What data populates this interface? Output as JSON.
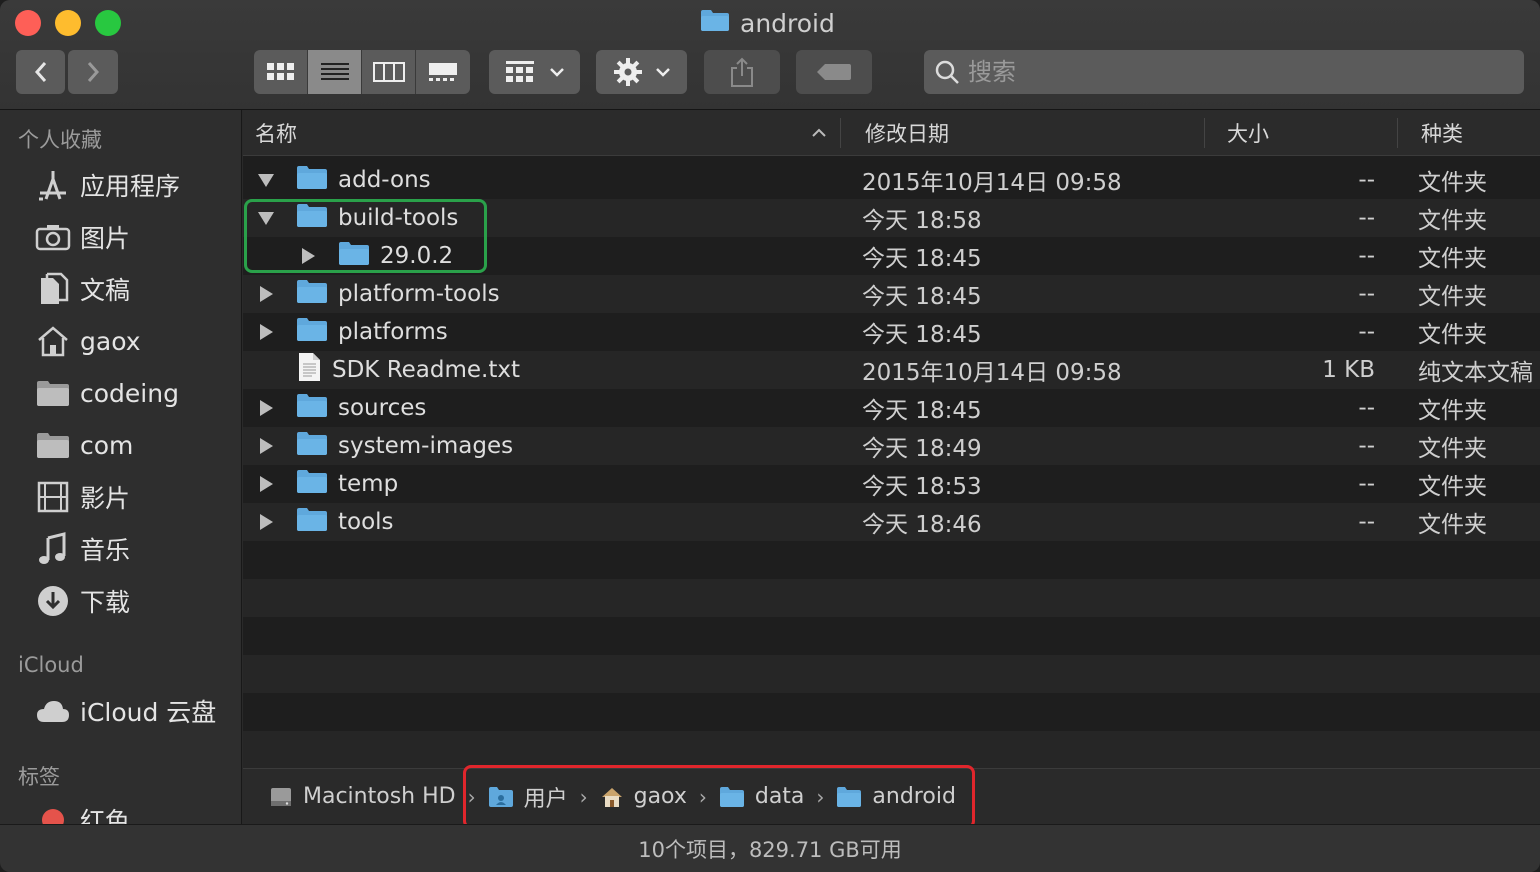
{
  "window": {
    "title": "android"
  },
  "search": {
    "placeholder": "搜索"
  },
  "sidebar": {
    "favorites_title": "个人收藏",
    "favorites": [
      {
        "label": "应用程序",
        "icon": "applications-icon"
      },
      {
        "label": "图片",
        "icon": "camera-icon"
      },
      {
        "label": "文稿",
        "icon": "documents-icon"
      },
      {
        "label": "gaox",
        "icon": "home-icon"
      },
      {
        "label": "codeing",
        "icon": "folder-icon"
      },
      {
        "label": "com",
        "icon": "folder-icon"
      },
      {
        "label": "影片",
        "icon": "film-icon"
      },
      {
        "label": "音乐",
        "icon": "music-icon"
      },
      {
        "label": "下载",
        "icon": "download-icon"
      }
    ],
    "icloud_title": "iCloud",
    "icloud": [
      {
        "label": "iCloud 云盘",
        "icon": "cloud-icon"
      }
    ],
    "tags_title": "标签",
    "tags": [
      {
        "label": "红色",
        "color": "#e5534b"
      }
    ]
  },
  "columns": {
    "name": "名称",
    "date": "修改日期",
    "size": "大小",
    "kind": "种类"
  },
  "files": [
    {
      "name": "add-ons",
      "date": "2015年10月14日 09:58",
      "size": "--",
      "kind": "文件夹",
      "type": "folder",
      "expanded": true,
      "indent": 0
    },
    {
      "name": "build-tools",
      "date": "今天 18:58",
      "size": "--",
      "kind": "文件夹",
      "type": "folder",
      "expanded": true,
      "indent": 0
    },
    {
      "name": "29.0.2",
      "date": "今天 18:45",
      "size": "--",
      "kind": "文件夹",
      "type": "folder",
      "expanded": false,
      "indent": 1
    },
    {
      "name": "platform-tools",
      "date": "今天 18:45",
      "size": "--",
      "kind": "文件夹",
      "type": "folder",
      "expanded": false,
      "indent": 0
    },
    {
      "name": "platforms",
      "date": "今天 18:45",
      "size": "--",
      "kind": "文件夹",
      "type": "folder",
      "expanded": false,
      "indent": 0
    },
    {
      "name": "SDK Readme.txt",
      "date": "2015年10月14日 09:58",
      "size": "1 KB",
      "kind": "纯文本文稿",
      "type": "file",
      "expanded": false,
      "indent": 0
    },
    {
      "name": "sources",
      "date": "今天 18:45",
      "size": "--",
      "kind": "文件夹",
      "type": "folder",
      "expanded": false,
      "indent": 0
    },
    {
      "name": "system-images",
      "date": "今天 18:49",
      "size": "--",
      "kind": "文件夹",
      "type": "folder",
      "expanded": false,
      "indent": 0
    },
    {
      "name": "temp",
      "date": "今天 18:53",
      "size": "--",
      "kind": "文件夹",
      "type": "folder",
      "expanded": false,
      "indent": 0
    },
    {
      "name": "tools",
      "date": "今天 18:46",
      "size": "--",
      "kind": "文件夹",
      "type": "folder",
      "expanded": false,
      "indent": 0
    }
  ],
  "pathbar": [
    {
      "label": "Macintosh HD",
      "icon": "hard-drive-icon"
    },
    {
      "label": "用户",
      "icon": "users-folder-icon"
    },
    {
      "label": "gaox",
      "icon": "home-icon"
    },
    {
      "label": "data",
      "icon": "folder-icon"
    },
    {
      "label": "android",
      "icon": "folder-icon"
    }
  ],
  "status": {
    "text": "10个项目，829.71 GB可用"
  },
  "colors": {
    "folder": "#5fa8dc",
    "highlight_green": "#2aa14a",
    "highlight_red": "#e0262c"
  }
}
